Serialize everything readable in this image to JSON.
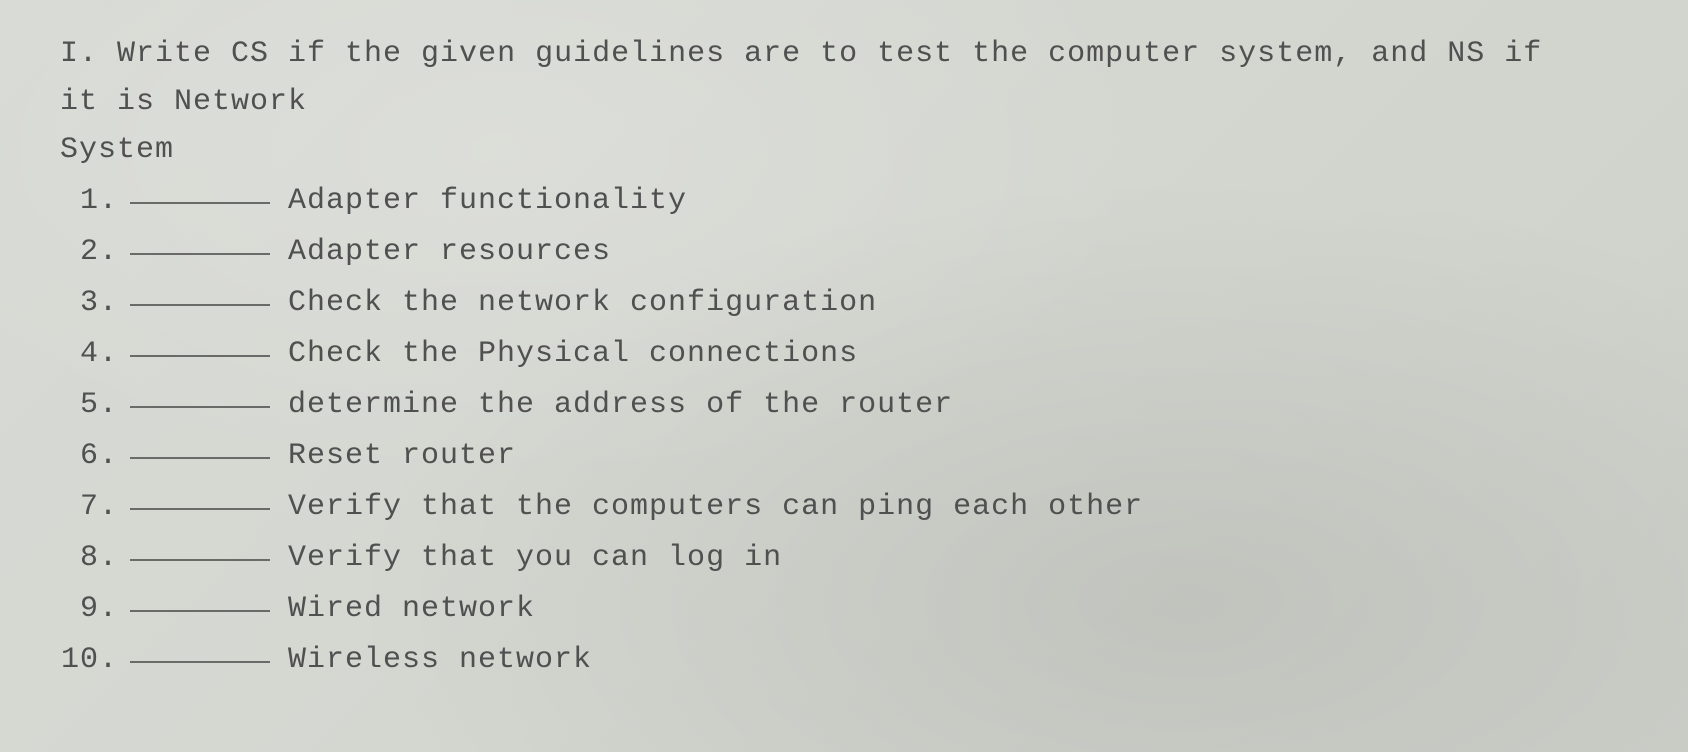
{
  "instruction": {
    "line1": "I. Write CS if the given guidelines are to test the computer system, and NS if",
    "line2": "it is Network",
    "line3": "System"
  },
  "questions": [
    {
      "number": "1.",
      "text": "Adapter functionality"
    },
    {
      "number": "2.",
      "text": "Adapter resources"
    },
    {
      "number": "3.",
      "text": "Check the network configuration"
    },
    {
      "number": "4.",
      "text": "Check the Physical connections"
    },
    {
      "number": "5.",
      "text": "determine the address of the router"
    },
    {
      "number": "6.",
      "text": "Reset router"
    },
    {
      "number": "7.",
      "text": "Verify that the computers can ping each other"
    },
    {
      "number": "8.",
      "text": "Verify that you can log in"
    },
    {
      "number": "9.",
      "text": "Wired network"
    },
    {
      "number": "10.",
      "text": "Wireless network"
    }
  ]
}
